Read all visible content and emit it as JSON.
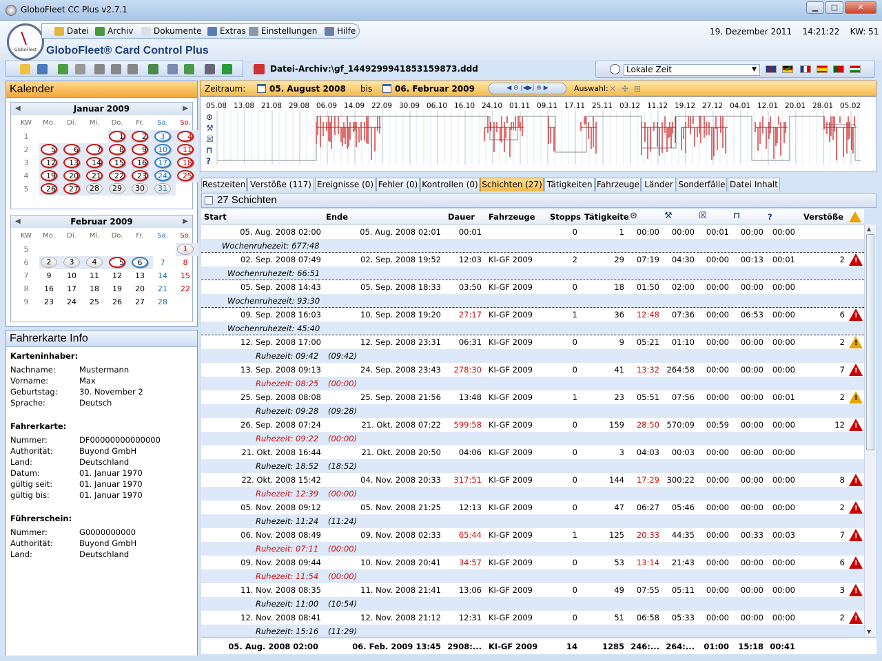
{
  "window": {
    "title": "GloboFleet CC Plus v2.7.1",
    "minimize": "▁",
    "maximize": "□",
    "close": "✕"
  },
  "app": {
    "brand": "GloboFleet® Card Control Plus",
    "logo_text": "GloboFleet"
  },
  "menu": [
    {
      "label": "Datei",
      "icon": "folder-icon"
    },
    {
      "label": "Archiv",
      "icon": "database-icon"
    },
    {
      "label": "Dokumente",
      "icon": "document-icon"
    },
    {
      "label": "Extras",
      "icon": "grid-icon"
    },
    {
      "label": "Einstellungen",
      "icon": "wrench-icon"
    },
    {
      "label": "Hilfe",
      "icon": "help-icon"
    }
  ],
  "header": {
    "date": "19. Dezember 2011",
    "time": "14:21:22",
    "kw": "KW: 51"
  },
  "file": {
    "path": "Datei-Archiv:\\gf_1449299941853159873.ddd"
  },
  "timezone": {
    "selected": "Lokale Zeit"
  },
  "calendar": {
    "title": "Kalender",
    "headers": [
      "KW",
      "Mo.",
      "Di.",
      "Mi.",
      "Do.",
      "Fr.",
      "Sa.",
      "So."
    ],
    "months": [
      {
        "name": "Januar 2009",
        "weeks": [
          {
            "kw": "1",
            "days": [
              "",
              "",
              "",
              "1",
              "2",
              "3",
              "4"
            ]
          },
          {
            "kw": "2",
            "days": [
              "5",
              "6",
              "7",
              "8",
              "9",
              "10",
              "11"
            ]
          },
          {
            "kw": "3",
            "days": [
              "12",
              "13",
              "14",
              "15",
              "16",
              "17",
              "18"
            ]
          },
          {
            "kw": "4",
            "days": [
              "19",
              "20",
              "21",
              "22",
              "23",
              "24",
              "25"
            ]
          },
          {
            "kw": "5",
            "days": [
              "26",
              "27",
              "28",
              "29",
              "30",
              "31",
              ""
            ]
          }
        ]
      },
      {
        "name": "Februar 2009",
        "weeks": [
          {
            "kw": "5",
            "days": [
              "",
              "",
              "",
              "",
              "",
              "",
              "1"
            ]
          },
          {
            "kw": "6",
            "days": [
              "2",
              "3",
              "4",
              "5",
              "6",
              "7",
              "8"
            ]
          },
          {
            "kw": "7",
            "days": [
              "9",
              "10",
              "11",
              "12",
              "13",
              "14",
              "15"
            ]
          },
          {
            "kw": "8",
            "days": [
              "16",
              "17",
              "18",
              "19",
              "20",
              "21",
              "22"
            ]
          },
          {
            "kw": "9",
            "days": [
              "23",
              "24",
              "25",
              "26",
              "27",
              "28",
              ""
            ]
          }
        ]
      }
    ]
  },
  "card_info": {
    "title": "Fahrerkarte Info",
    "sections": [
      {
        "heading": "Karteninhaber:",
        "fields": [
          {
            "label": "Nachname:",
            "value": "Mustermann"
          },
          {
            "label": "Vorname:",
            "value": "Max"
          },
          {
            "label": "Geburtstag:",
            "value": "30. November 2"
          },
          {
            "label": "Sprache:",
            "value": "Deutsch"
          }
        ]
      },
      {
        "heading": "Fahrerkarte:",
        "fields": [
          {
            "label": "Nummer:",
            "value": "DF00000000000000"
          },
          {
            "label": "Authorität:",
            "value": "Buyond GmbH"
          },
          {
            "label": "Land:",
            "value": "Deutschland"
          },
          {
            "label": "Datum:",
            "value": "01. Januar 1970"
          },
          {
            "label": "gültig seit:",
            "value": "01. Januar 1970"
          },
          {
            "label": "gültig bis:",
            "value": "01. Januar 1970"
          }
        ]
      },
      {
        "heading": "Führerschein:",
        "fields": [
          {
            "label": "Nummer:",
            "value": "G0000000000"
          },
          {
            "label": "Authorität:",
            "value": "Buyond GmbH"
          },
          {
            "label": "Land:",
            "value": "Deutschland"
          }
        ]
      }
    ]
  },
  "zeitraum": {
    "label": "Zeitraum:",
    "from": "05. August 2008",
    "bis": "bis",
    "to": "06. Februar 2009",
    "auswahl": "Auswahl:",
    "zoom_controls": "◀ ⊖ |◀▶| ⊕ ▶"
  },
  "timeline": {
    "dates": [
      "05.08",
      "13.08",
      "21.08",
      "29.08",
      "06.09",
      "14.09",
      "22.09",
      "30.09",
      "06.10",
      "16.10",
      "24.10",
      "01.11",
      "09.11",
      "17.11",
      "25.11",
      "03.12",
      "11.12",
      "19.12",
      "27.12",
      "04.01",
      "12.01",
      "20.01",
      "28.01",
      "05.02"
    ],
    "row_icons": [
      "clock-icon",
      "tools-icon",
      "box-icon",
      "bed-icon",
      "question-icon"
    ],
    "unknown_label": "?"
  },
  "tabs": [
    {
      "label": "Restzeiten",
      "active": false
    },
    {
      "label": "Verstöße (117)",
      "active": false
    },
    {
      "label": "Ereignisse (0)",
      "active": false
    },
    {
      "label": "Fehler (0)",
      "active": false
    },
    {
      "label": "Kontrollen (0)",
      "active": false
    },
    {
      "label": "Schichten (27)",
      "active": true
    },
    {
      "label": "Tätigkeiten",
      "active": false
    },
    {
      "label": "Fahrzeuge",
      "active": false
    },
    {
      "label": "Länder",
      "active": false
    },
    {
      "label": "Sonderfälle",
      "active": false
    },
    {
      "label": "Datei Inhalt",
      "active": false
    }
  ],
  "grid": {
    "title": "27 Schichten",
    "columns": [
      "Start",
      "Ende",
      "Dauer",
      "Fahrzeuge",
      "Stopps",
      "Tätigkeite",
      "clock-icon",
      "tools-icon",
      "box-icon",
      "bed-icon",
      "?",
      "Verstöße",
      "warning-icon"
    ],
    "unknown_col_label": "?",
    "rows": [
      {
        "start": "05. Aug. 2008 02:00",
        "ende": "05. Aug. 2008 02:01",
        "dauer": "00:01",
        "dauer_red": false,
        "fz": "",
        "stopps": "0",
        "taet": "1",
        "lenk": "00:00",
        "lenk_red": false,
        "arb": "00:00",
        "bereit": "00:01",
        "ruhe": "00:00",
        "unbek": "00:00",
        "verst": "",
        "warn": "none",
        "sub": "Wochenruhezeit: 677:48",
        "sub2": "",
        "sub_red": false,
        "sub_indent": false,
        "dashed": true
      },
      {
        "start": "02. Sep. 2008 07:49",
        "ende": "02. Sep. 2008 19:52",
        "dauer": "12:03",
        "dauer_red": false,
        "fz": "KI-GF 2009",
        "stopps": "2",
        "taet": "29",
        "lenk": "07:19",
        "lenk_red": false,
        "arb": "04:30",
        "bereit": "00:00",
        "ruhe": "00:13",
        "unbek": "00:01",
        "verst": "2",
        "warn": "red",
        "sub": "Wochenruhezeit: 66:51",
        "sub2": "",
        "sub_red": false,
        "sub_indent": true,
        "dashed": true
      },
      {
        "start": "05. Sep. 2008 14:43",
        "ende": "05. Sep. 2008 18:33",
        "dauer": "03:50",
        "dauer_red": false,
        "fz": "KI-GF 2009",
        "stopps": "0",
        "taet": "18",
        "lenk": "01:50",
        "lenk_red": false,
        "arb": "02:00",
        "bereit": "00:00",
        "ruhe": "00:00",
        "unbek": "00:00",
        "verst": "",
        "warn": "none",
        "sub": "Wochenruhezeit: 93:30",
        "sub2": "",
        "sub_red": false,
        "sub_indent": true,
        "dashed": true
      },
      {
        "start": "09. Sep. 2008 16:03",
        "ende": "10. Sep. 2008 19:20",
        "dauer": "27:17",
        "dauer_red": true,
        "fz": "KI-GF 2009",
        "stopps": "1",
        "taet": "36",
        "lenk": "12:48",
        "lenk_red": true,
        "arb": "07:36",
        "bereit": "00:00",
        "ruhe": "06:53",
        "unbek": "00:00",
        "verst": "6",
        "warn": "red",
        "sub": "Wochenruhezeit: 45:40",
        "sub2": "",
        "sub_red": false,
        "sub_indent": true,
        "dashed": true
      },
      {
        "start": "12. Sep. 2008 17:00",
        "ende": "12. Sep. 2008 23:31",
        "dauer": "06:31",
        "dauer_red": false,
        "fz": "KI-GF 2009",
        "stopps": "0",
        "taet": "9",
        "lenk": "05:21",
        "lenk_red": false,
        "arb": "01:10",
        "bereit": "00:00",
        "ruhe": "00:00",
        "unbek": "00:00",
        "verst": "2",
        "warn": "yellow",
        "sub": "Ruhezeit: 09:42",
        "sub2": "(09:42)",
        "sub_red": false,
        "sub_indent": true,
        "dashed": false
      },
      {
        "start": "13. Sep. 2008 09:13",
        "ende": "24. Sep. 2008 23:43",
        "dauer": "278:30",
        "dauer_red": true,
        "fz": "KI-GF 2009",
        "stopps": "0",
        "taet": "41",
        "lenk": "13:32",
        "lenk_red": true,
        "arb": "264:58",
        "bereit": "00:00",
        "ruhe": "00:00",
        "unbek": "00:00",
        "verst": "7",
        "warn": "red",
        "sub": "Ruhezeit: 08:25",
        "sub2": "(00:00)",
        "sub_red": true,
        "sub_indent": true,
        "dashed": false
      },
      {
        "start": "25. Sep. 2008 08:08",
        "ende": "25. Sep. 2008 21:56",
        "dauer": "13:48",
        "dauer_red": false,
        "fz": "KI-GF 2009",
        "stopps": "1",
        "taet": "23",
        "lenk": "05:51",
        "lenk_red": false,
        "arb": "07:56",
        "bereit": "00:00",
        "ruhe": "00:00",
        "unbek": "00:01",
        "verst": "2",
        "warn": "yellow",
        "sub": "Ruhezeit: 09:28",
        "sub2": "(09:28)",
        "sub_red": false,
        "sub_indent": true,
        "dashed": false
      },
      {
        "start": "26. Sep. 2008 07:24",
        "ende": "21. Okt. 2008 07:22",
        "dauer": "599:58",
        "dauer_red": true,
        "fz": "KI-GF 2009",
        "stopps": "0",
        "taet": "159",
        "lenk": "28:50",
        "lenk_red": true,
        "arb": "570:09",
        "bereit": "00:59",
        "ruhe": "00:00",
        "unbek": "00:00",
        "verst": "12",
        "warn": "red",
        "sub": "Ruhezeit: 09:22",
        "sub2": "(00:00)",
        "sub_red": true,
        "sub_indent": true,
        "dashed": false
      },
      {
        "start": "21. Okt. 2008 16:44",
        "ende": "21. Okt. 2008 20:50",
        "dauer": "04:06",
        "dauer_red": false,
        "fz": "KI-GF 2009",
        "stopps": "0",
        "taet": "3",
        "lenk": "04:03",
        "lenk_red": false,
        "arb": "00:03",
        "bereit": "00:00",
        "ruhe": "00:00",
        "unbek": "00:00",
        "verst": "",
        "warn": "none",
        "sub": "Ruhezeit: 18:52",
        "sub2": "(18:52)",
        "sub_red": false,
        "sub_indent": true,
        "dashed": false
      },
      {
        "start": "22. Okt. 2008 15:42",
        "ende": "04. Nov. 2008 20:33",
        "dauer": "317:51",
        "dauer_red": true,
        "fz": "KI-GF 2009",
        "stopps": "0",
        "taet": "144",
        "lenk": "17:29",
        "lenk_red": true,
        "arb": "300:22",
        "bereit": "00:00",
        "ruhe": "00:00",
        "unbek": "00:00",
        "verst": "8",
        "warn": "red",
        "sub": "Ruhezeit: 12:39",
        "sub2": "(00:00)",
        "sub_red": true,
        "sub_indent": true,
        "dashed": false
      },
      {
        "start": "05. Nov. 2008 09:12",
        "ende": "05. Nov. 2008 21:25",
        "dauer": "12:13",
        "dauer_red": false,
        "fz": "KI-GF 2009",
        "stopps": "0",
        "taet": "47",
        "lenk": "06:27",
        "lenk_red": false,
        "arb": "05:46",
        "bereit": "00:00",
        "ruhe": "00:00",
        "unbek": "00:00",
        "verst": "2",
        "warn": "red",
        "sub": "Ruhezeit: 11:24",
        "sub2": "(11:24)",
        "sub_red": false,
        "sub_indent": true,
        "dashed": false
      },
      {
        "start": "06. Nov. 2008 08:49",
        "ende": "09. Nov. 2008 02:33",
        "dauer": "65:44",
        "dauer_red": true,
        "fz": "KI-GF 2009",
        "stopps": "1",
        "taet": "125",
        "lenk": "20:33",
        "lenk_red": true,
        "arb": "44:35",
        "bereit": "00:00",
        "ruhe": "00:33",
        "unbek": "00:03",
        "verst": "7",
        "warn": "red",
        "sub": "Ruhezeit: 07:11",
        "sub2": "(00:00)",
        "sub_red": true,
        "sub_indent": true,
        "dashed": false
      },
      {
        "start": "09. Nov. 2008 09:44",
        "ende": "10. Nov. 2008 20:41",
        "dauer": "34:57",
        "dauer_red": true,
        "fz": "KI-GF 2009",
        "stopps": "0",
        "taet": "53",
        "lenk": "13:14",
        "lenk_red": true,
        "arb": "21:43",
        "bereit": "00:00",
        "ruhe": "00:00",
        "unbek": "00:00",
        "verst": "6",
        "warn": "red",
        "sub": "Ruhezeit: 11:54",
        "sub2": "(00:00)",
        "sub_red": true,
        "sub_indent": true,
        "dashed": false
      },
      {
        "start": "11. Nov. 2008 08:35",
        "ende": "11. Nov. 2008 21:41",
        "dauer": "13:06",
        "dauer_red": false,
        "fz": "KI-GF 2009",
        "stopps": "0",
        "taet": "49",
        "lenk": "07:55",
        "lenk_red": false,
        "arb": "05:11",
        "bereit": "00:00",
        "ruhe": "00:00",
        "unbek": "00:00",
        "verst": "3",
        "warn": "red",
        "sub": "Ruhezeit: 11:00",
        "sub2": "(10:54)",
        "sub_red": false,
        "sub_indent": true,
        "dashed": false
      },
      {
        "start": "12. Nov. 2008 08:41",
        "ende": "12. Nov. 2008 21:12",
        "dauer": "12:31",
        "dauer_red": false,
        "fz": "KI-GF 2009",
        "stopps": "0",
        "taet": "51",
        "lenk": "06:58",
        "lenk_red": false,
        "arb": "05:33",
        "bereit": "00:00",
        "ruhe": "00:00",
        "unbek": "00:00",
        "verst": "2",
        "warn": "red",
        "sub": "Ruhezeit: 15:16",
        "sub2": "(11:29)",
        "sub_red": false,
        "sub_indent": true,
        "dashed": false
      }
    ],
    "summary": {
      "start": "05. Aug. 2008 02:00",
      "ende": "06. Feb. 2009 13:45",
      "dauer": "2908:...",
      "fz": "KI-GF 2009",
      "stopps": "14",
      "taet": "1285",
      "lenk": "246:...",
      "arb": "264:...",
      "bereit": "01:00",
      "ruhe": "15:18",
      "unbek": "00:41"
    }
  }
}
